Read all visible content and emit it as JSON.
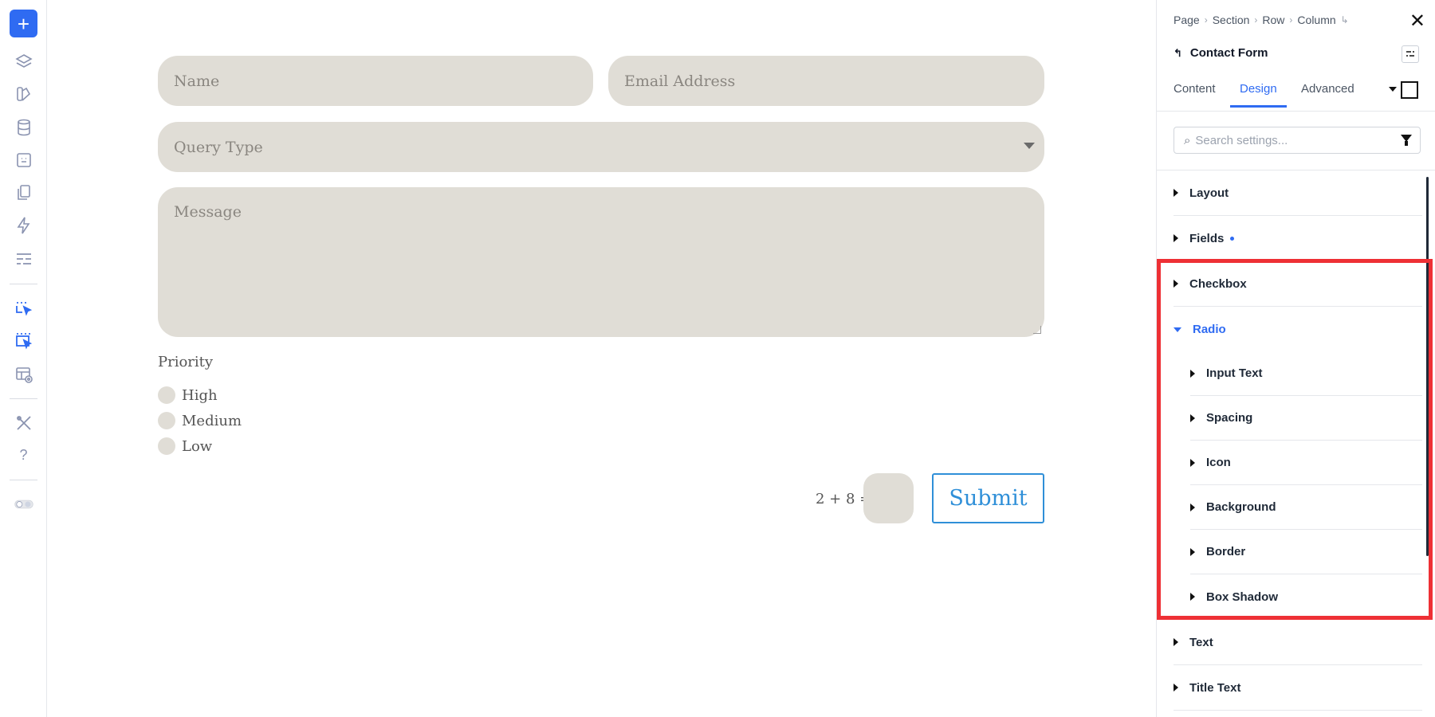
{
  "toolbar": {
    "add_label": "+",
    "icons": [
      "layers-icon",
      "paint-icon",
      "database-icon",
      "portability-icon",
      "pages-icon",
      "lightning-icon",
      "layout-icon",
      "select-element-icon",
      "select-multiple-icon",
      "preview-icon",
      "tools-icon",
      "help-icon",
      "theme-toggle-icon"
    ],
    "help_label": "?"
  },
  "form": {
    "name_placeholder": "Name",
    "email_placeholder": "Email Address",
    "query_placeholder": "Query Type",
    "message_placeholder": "Message",
    "priority_label": "Priority",
    "radio_options": [
      "High",
      "Medium",
      "Low"
    ],
    "captcha_question": "2 + 8 =",
    "submit_label": "Submit",
    "colors": {
      "field_bg": "#e0ddd6",
      "submit_accent": "#2f8fd8"
    }
  },
  "panel": {
    "breadcrumb": [
      "Page",
      "Section",
      "Row",
      "Column"
    ],
    "title": "Contact Form",
    "tabs": [
      "Content",
      "Design",
      "Advanced"
    ],
    "active_tab": "Design",
    "search_placeholder": "Search settings...",
    "groups": [
      {
        "label": "Layout",
        "open": false
      },
      {
        "label": "Fields",
        "open": false,
        "modified": true
      },
      {
        "label": "Checkbox",
        "open": false
      },
      {
        "label": "Radio",
        "open": true
      }
    ],
    "radio_subgroups": [
      "Input Text",
      "Spacing",
      "Icon",
      "Background",
      "Border",
      "Box Shadow"
    ],
    "groups_after": [
      {
        "label": "Text"
      },
      {
        "label": "Title Text"
      }
    ],
    "colors": {
      "accent": "#2f6bf2",
      "highlight": "#ee3035"
    }
  }
}
